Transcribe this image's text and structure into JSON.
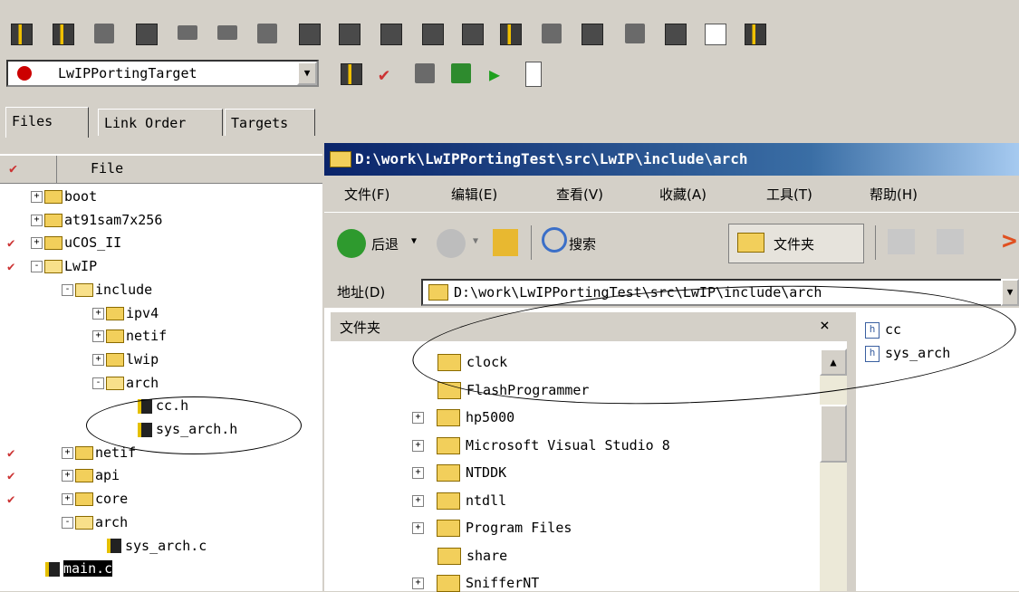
{
  "ide": {
    "target": "LwIPPortingTarget",
    "tabs": [
      "Files",
      "Link Order",
      "Targets"
    ],
    "file_column_header": "File",
    "tree": [
      {
        "label": "boot",
        "kind": "folder",
        "toggle": "+",
        "indent": 0,
        "check": false
      },
      {
        "label": "at91sam7x256",
        "kind": "folder",
        "toggle": "+",
        "indent": 0,
        "check": false
      },
      {
        "label": "uCOS_II",
        "kind": "folder",
        "toggle": "+",
        "indent": 0,
        "check": true
      },
      {
        "label": "LwIP",
        "kind": "folder-open",
        "toggle": "-",
        "indent": 0,
        "check": true
      },
      {
        "label": "include",
        "kind": "folder-open",
        "toggle": "-",
        "indent": 1,
        "check": false
      },
      {
        "label": "ipv4",
        "kind": "folder",
        "toggle": "+",
        "indent": 2,
        "check": false
      },
      {
        "label": "netif",
        "kind": "folder",
        "toggle": "+",
        "indent": 2,
        "check": false
      },
      {
        "label": "lwip",
        "kind": "folder",
        "toggle": "+",
        "indent": 2,
        "check": false
      },
      {
        "label": "arch",
        "kind": "folder-open",
        "toggle": "-",
        "indent": 2,
        "check": false
      },
      {
        "label": "cc.h",
        "kind": "file",
        "toggle": "",
        "indent": 3,
        "check": false
      },
      {
        "label": "sys_arch.h",
        "kind": "file",
        "toggle": "",
        "indent": 3,
        "check": false
      },
      {
        "label": "netif",
        "kind": "folder",
        "toggle": "+",
        "indent": 1,
        "check": true
      },
      {
        "label": "api",
        "kind": "folder",
        "toggle": "+",
        "indent": 1,
        "check": true
      },
      {
        "label": "core",
        "kind": "folder",
        "toggle": "+",
        "indent": 1,
        "check": true
      },
      {
        "label": "arch",
        "kind": "folder-open",
        "toggle": "-",
        "indent": 1,
        "check": false
      },
      {
        "label": "sys_arch.c",
        "kind": "file",
        "toggle": "",
        "indent": 2,
        "check": false
      },
      {
        "label": "main.c",
        "kind": "file-selected",
        "toggle": "",
        "indent": 0,
        "check": false
      }
    ]
  },
  "explorer": {
    "title": "D:\\work\\LwIPPortingTest\\src\\LwIP\\include\\arch",
    "menu": [
      "文件(F)",
      "编辑(E)",
      "查看(V)",
      "收藏(A)",
      "工具(T)",
      "帮助(H)"
    ],
    "toolbar": {
      "back": "后退",
      "search": "搜索",
      "folders": "文件夹"
    },
    "address_label": "地址(D)",
    "address_value": "D:\\work\\LwIPPortingTest\\src\\LwIP\\include\\arch",
    "folders_label": "文件夹",
    "close_glyph": "×",
    "folders": [
      {
        "label": "clock",
        "toggle": ""
      },
      {
        "label": "FlashProgrammer",
        "toggle": ""
      },
      {
        "label": "hp5000",
        "toggle": "+"
      },
      {
        "label": "Microsoft Visual Studio 8",
        "toggle": "+"
      },
      {
        "label": "NTDDK",
        "toggle": "+"
      },
      {
        "label": "ntdll",
        "toggle": "+"
      },
      {
        "label": "Program Files",
        "toggle": "+"
      },
      {
        "label": "share",
        "toggle": ""
      },
      {
        "label": "SnifferNT",
        "toggle": "+"
      }
    ],
    "files": [
      "cc",
      "sys_arch"
    ]
  },
  "colors": {
    "titlebar": "#0a246a",
    "check": "#cc3333"
  }
}
